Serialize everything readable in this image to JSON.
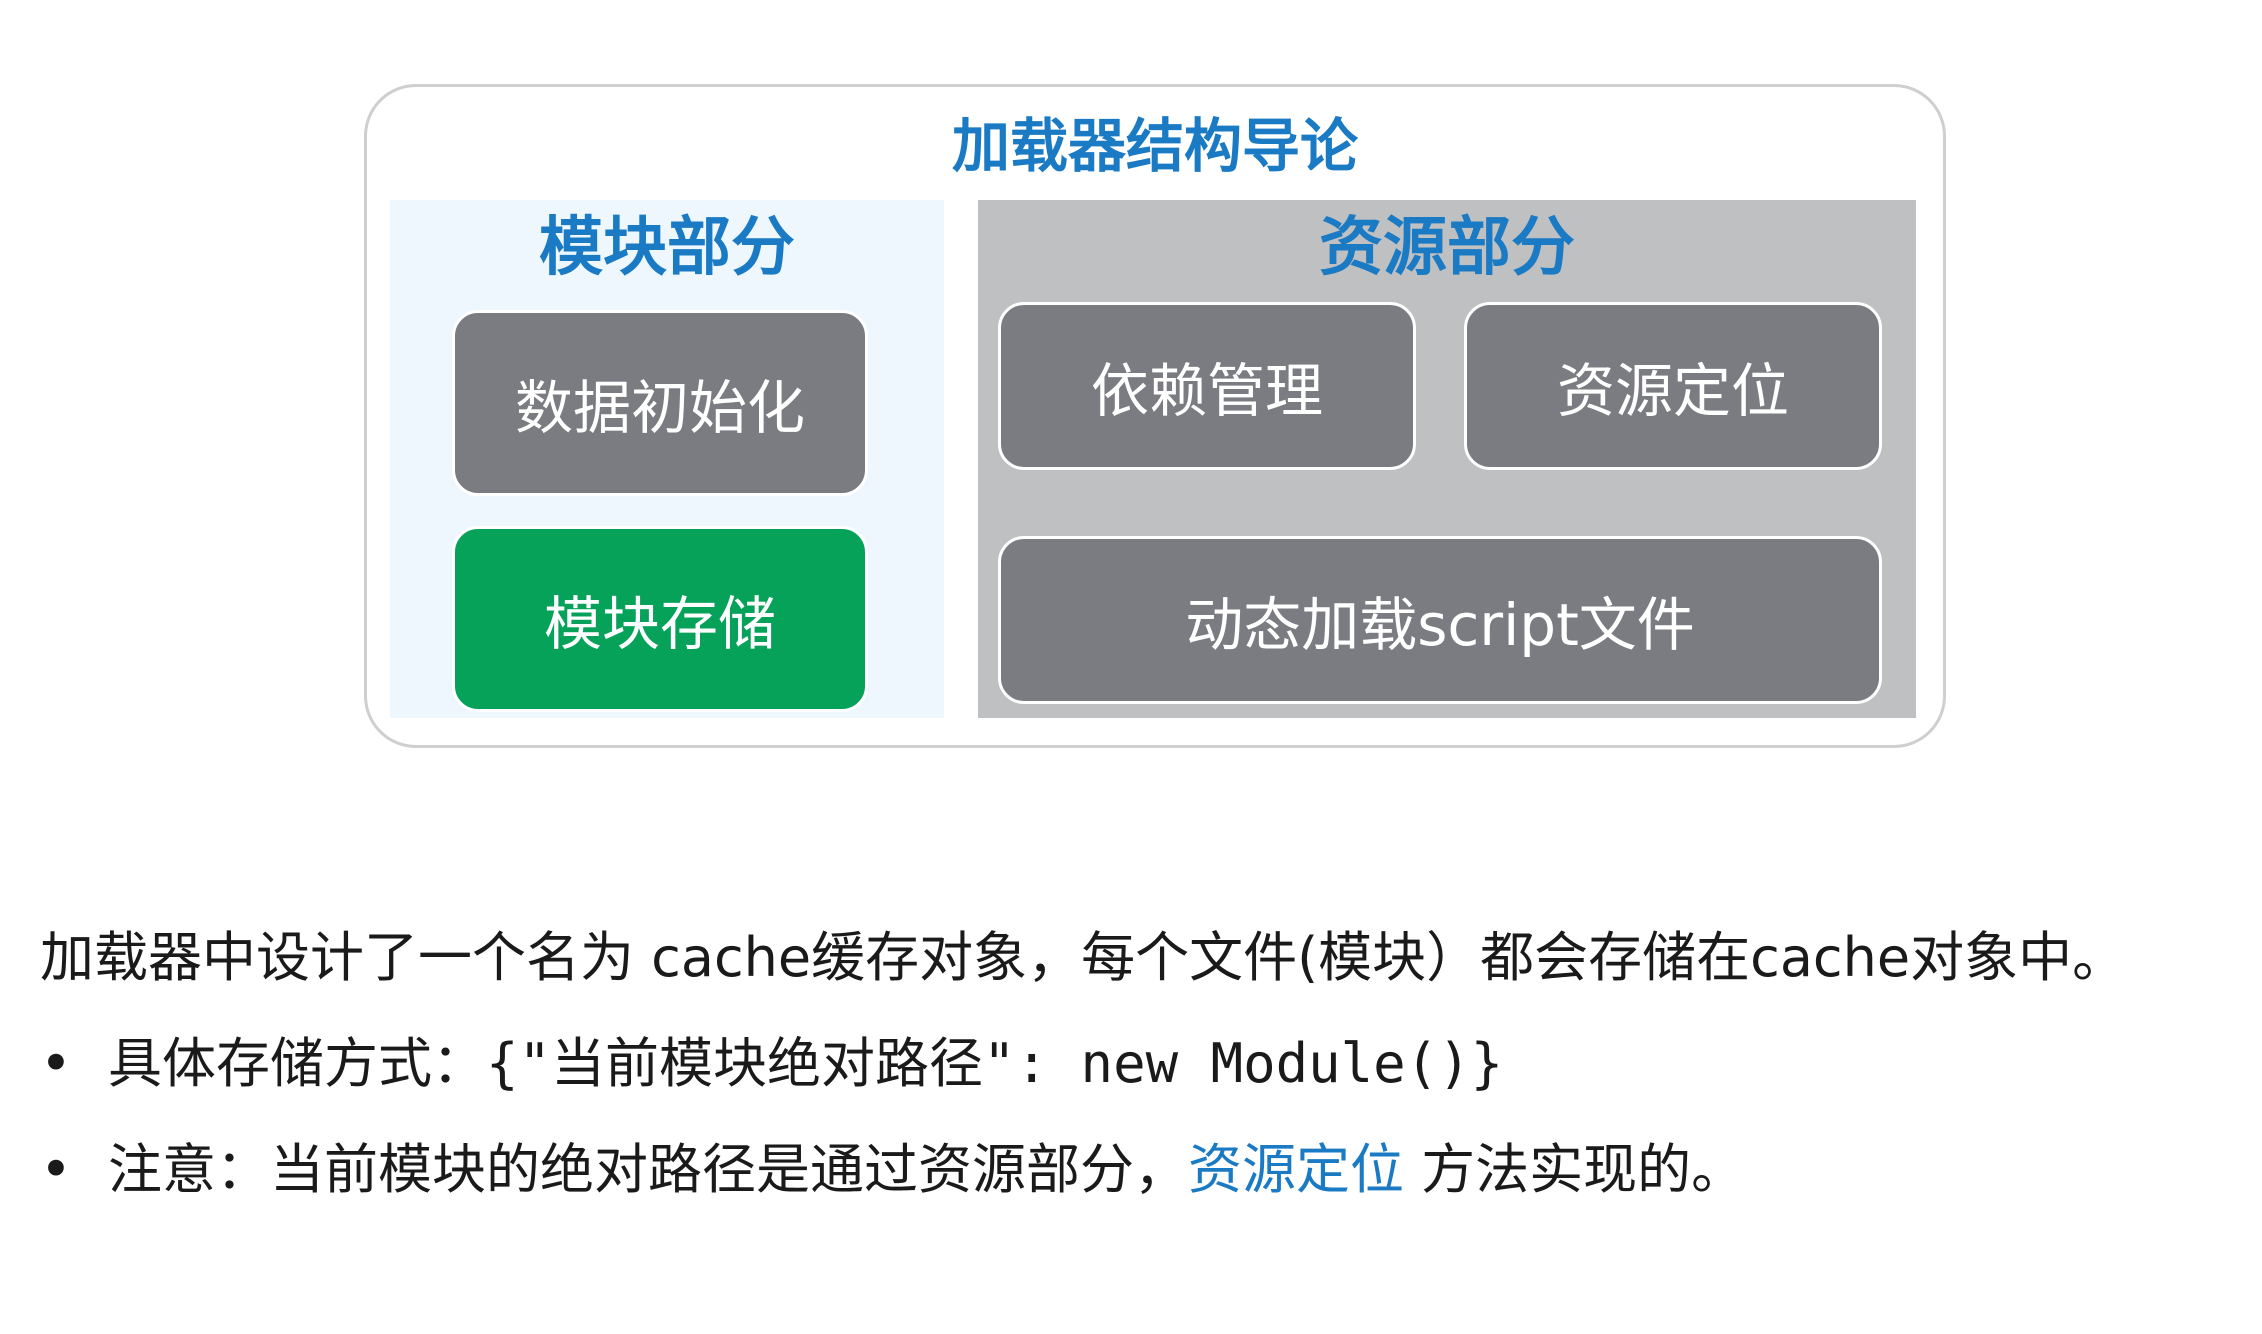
{
  "diagram": {
    "title": "加载器结构导论",
    "module_panel": {
      "title": "模块部分",
      "boxes": [
        "数据初始化",
        "模块存储"
      ]
    },
    "resource_panel": {
      "title": "资源部分",
      "boxes": [
        "依赖管理",
        "资源定位",
        "动态加载script文件"
      ]
    },
    "colors": {
      "title_blue": "#1a7ac4",
      "box_gray": "#7a7c82",
      "box_green": "#07a25a",
      "module_panel_bg": "#eef7fe",
      "resource_panel_bg": "#bfc0c2"
    }
  },
  "text": {
    "caption": "加载器中设计了一个名为 cache缓存对象，每个文件(模块）都会存储在cache对象中。",
    "bullet_symbol": "•",
    "bullet1_prefix": "具体存储方式：",
    "bullet1_code": "{\"当前模块绝对路径\": new Module()}",
    "bullet2_prefix": "注意：当前模块的绝对路径是通过资源部分，",
    "bullet2_highlight": "资源定位",
    "bullet2_suffix": " 方法实现的。"
  }
}
